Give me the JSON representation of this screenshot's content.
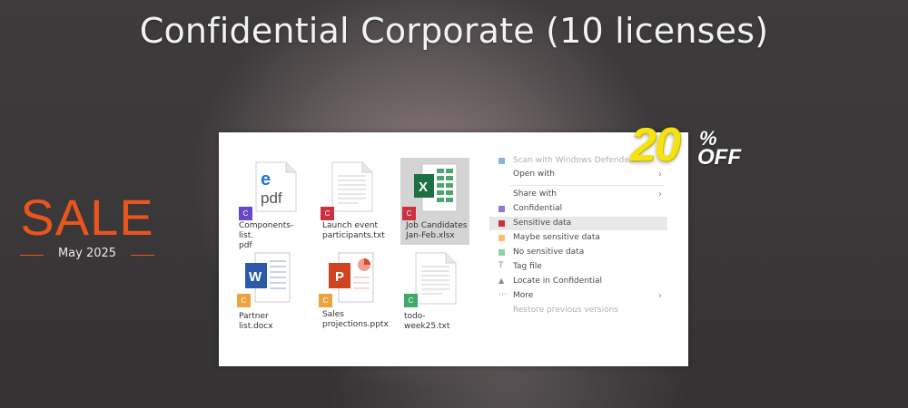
{
  "title": "Confidential Corporate (10 licenses)",
  "sale": {
    "word": "SALE",
    "date": "May 2025"
  },
  "discount": {
    "number": "20",
    "percent": "%",
    "off": "OFF"
  },
  "files": [
    {
      "name": "Components-list.\npdf",
      "badge": "C",
      "badge_color": "purple",
      "icon": "pdf-edge-icon"
    },
    {
      "name": "Launch event\nparticipants.txt",
      "badge": "C",
      "badge_color": "red",
      "icon": "text-document-icon"
    },
    {
      "name": "Job Candidates\nJan-Feb.xlsx",
      "badge": "C",
      "badge_color": "red",
      "icon": "excel-icon",
      "selected": true
    },
    {
      "name": "Partner list.docx",
      "badge": "C",
      "badge_color": "orange",
      "icon": "word-icon"
    },
    {
      "name": "Sales\nprojections.pptx",
      "badge": "C",
      "badge_color": "orange",
      "icon": "powerpoint-icon"
    },
    {
      "name": "todo-week25.txt",
      "badge": "C",
      "badge_color": "green",
      "icon": "text-document-icon"
    }
  ],
  "context_menu": {
    "items": [
      {
        "label": "Scan with Windows Defender...",
        "icon": "defender-icon",
        "faded": true
      },
      {
        "label": "Open with",
        "icon": "",
        "arrow": true
      },
      {
        "label": "Share with",
        "icon": "",
        "arrow": true
      },
      {
        "label": "Confidential",
        "icon": "purple-square-icon"
      },
      {
        "label": "Sensitive data",
        "icon": "red-square-icon",
        "highlighted": true
      },
      {
        "label": "Maybe sensitive data",
        "icon": "orange-square-icon"
      },
      {
        "label": "No sensitive data",
        "icon": "green-square-icon"
      },
      {
        "label": "Tag file",
        "icon": "tag-icon"
      },
      {
        "label": "Locate in Confidential",
        "icon": "locate-icon"
      },
      {
        "label": "More",
        "icon": "more-icon",
        "arrow": true
      },
      {
        "label": "Restore previous versions",
        "icon": "",
        "faded": true
      }
    ]
  },
  "colors": {
    "sale_orange": "#e9551f",
    "discount_yellow": "#f5e311",
    "badge_purple": "#6a46c8",
    "badge_red": "#c9323e",
    "badge_orange": "#eea340",
    "badge_green": "#41a86a"
  }
}
